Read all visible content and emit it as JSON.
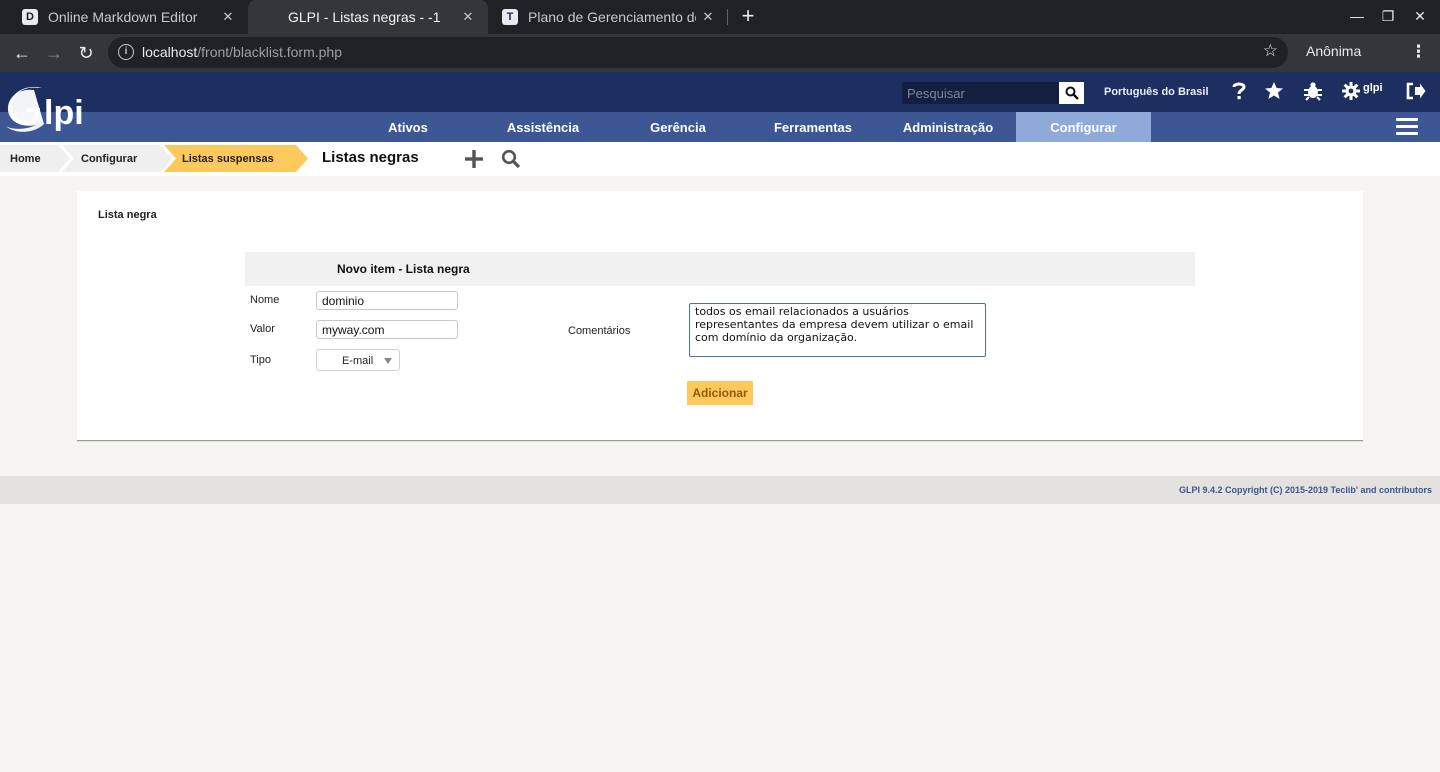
{
  "browser": {
    "tabs": [
      {
        "favicon": "D",
        "title": "Online Markdown Editor",
        "active": false
      },
      {
        "favicon": "",
        "title": "GLPI - Listas negras - -1",
        "active": true
      },
      {
        "favicon": "T",
        "title": "Plano de Gerenciamento de",
        "active": false
      }
    ],
    "url_host": "localhost",
    "url_path": "/front/blacklist.form.php",
    "profile": "Anônima"
  },
  "header": {
    "logo_text": "Glpi",
    "search_placeholder": "Pesquisar",
    "language": "Português do Brasil",
    "user": "glpi"
  },
  "menu": {
    "items": [
      {
        "label": "Ativos",
        "active": false
      },
      {
        "label": "Assistência",
        "active": false
      },
      {
        "label": "Gerência",
        "active": false
      },
      {
        "label": "Ferramentas",
        "active": false
      },
      {
        "label": "Administração",
        "active": false
      },
      {
        "label": "Configurar",
        "active": true
      }
    ]
  },
  "breadcrumb": {
    "items": [
      "Home",
      "Configurar",
      "Listas suspensas"
    ],
    "page": "Listas negras"
  },
  "content": {
    "title": "Lista negra",
    "form_header": "Novo item - Lista negra",
    "fields": {
      "nome_label": "Nome",
      "nome_value": "dominio",
      "valor_label": "Valor",
      "valor_value": "myway.com",
      "tipo_label": "Tipo",
      "tipo_value": "E-mail",
      "comentarios_label": "Comentários",
      "comentarios_value": "todos os email relacionados a usuários representantes da empresa devem utilizar o email com domínio da organização."
    },
    "submit_label": "Adicionar"
  },
  "footer": {
    "text": "GLPI 9.4.2 Copyright (C) 2015-2019 Teclib' and contributors"
  },
  "colors": {
    "header_dark": "#1d2f60",
    "menu_bar": "#3c5794",
    "menu_active": "#8fa9d9",
    "crumb_active": "#fec95c",
    "button": "#fec95c"
  }
}
